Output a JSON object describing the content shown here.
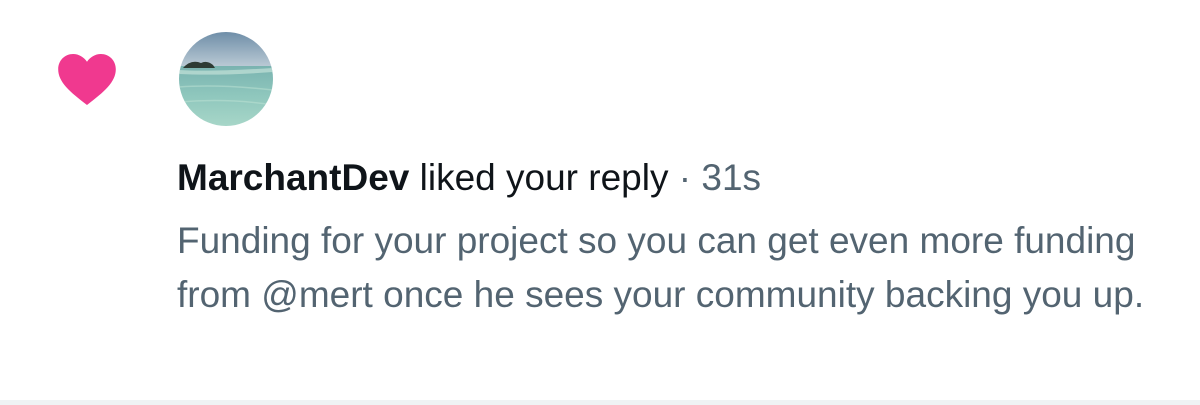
{
  "notification": {
    "type_icon": "heart-icon",
    "accent_color": "#f91880",
    "avatar_icon": "beach-photo-avatar",
    "username": "MarchantDev",
    "action": "liked your reply",
    "separator": "·",
    "time": "31s",
    "reply_text": "Funding for your project so you can get even more funding from @mert once he sees your community backing you up."
  }
}
